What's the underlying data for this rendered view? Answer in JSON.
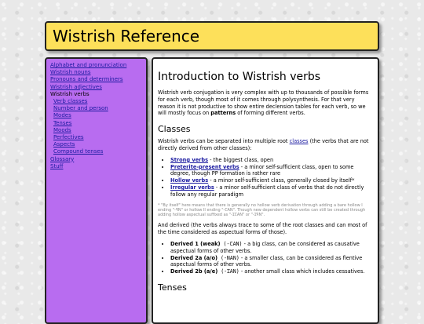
{
  "header": {
    "title": "Wistrish Reference"
  },
  "sidebar": {
    "items": [
      {
        "label": "Alphabet and pronunciation"
      },
      {
        "label": "Wistrish nouns"
      },
      {
        "label": "Pronouns and determiners"
      },
      {
        "label": "Wistrish adjectives"
      },
      {
        "label": "Wistrish verbs"
      },
      {
        "label": "Verb classes"
      },
      {
        "label": "Number and person"
      },
      {
        "label": "Modes"
      },
      {
        "label": "Tenses"
      },
      {
        "label": "Moods"
      },
      {
        "label": "Perfectives"
      },
      {
        "label": "Aspects"
      },
      {
        "label": "Compound tenses"
      },
      {
        "label": "Glossary"
      },
      {
        "label": "Stuff"
      }
    ]
  },
  "main": {
    "title": "Introduction to Wistrish verbs",
    "intro": {
      "a": "Wistrish verb conjugation is very complex with up to thousands of possible forms for each verb, though most of it comes through polysynthesis. For that very reason it is not productive to show entire declension tables for each verb, so we will mostly focus on ",
      "b": "patterns",
      "c": " of forming different verbs."
    },
    "classes_heading": "Classes",
    "classes_p": {
      "a": "Wistrish verbs can be separated into multiple root ",
      "link": "classes",
      "b": " (the verbs that are not directly derived from other classes):"
    },
    "root_classes": [
      {
        "name": "Strong verbs",
        "desc": " - the biggest class, open"
      },
      {
        "name": "Preterite-present verbs",
        "desc": " - a minor self-sufficient class, open to some degree, though PP formation is rather rare"
      },
      {
        "name": "Hollow verbs",
        "desc": " - a minor self-sufficient class, generally closed by itself*"
      },
      {
        "name": "Irregular verbs",
        "desc": " - a minor self-sufficient class of verbs that do not directly follow any regular paradigm"
      }
    ],
    "note": "* \"By itself\" here means that there is generally no hollow verb derivation through adding a bare hollow I ending \"-ꟼN\" or hollow II ending \"-ꞆAN\". Though new dependent hollow verbs can still be created through adding hollow aspectual suffixed as \"-ꞮꞆAN\" or \"-ꞮꟼN\".",
    "derived_p": "And derived (the verbs always trace to some of the root classes and can most of the time considered as aspectual forms of those).",
    "derived": [
      {
        "name": "Derived 1 (weak)",
        "suffix": " (-ꞆAN)",
        "desc": " - a big class, can be considered as causative aspectual forms of other verbs."
      },
      {
        "name": "Derived 2a (a/o)",
        "suffix": " (-NAN)",
        "desc": " - a smaller class, can be considered as fientive aspectual forms of other verbs."
      },
      {
        "name": "Derived 2b (a/e)",
        "suffix": " (-ꞮAN)",
        "desc": " - another small class which includes cessatives."
      }
    ],
    "tenses_heading": "Tenses"
  }
}
